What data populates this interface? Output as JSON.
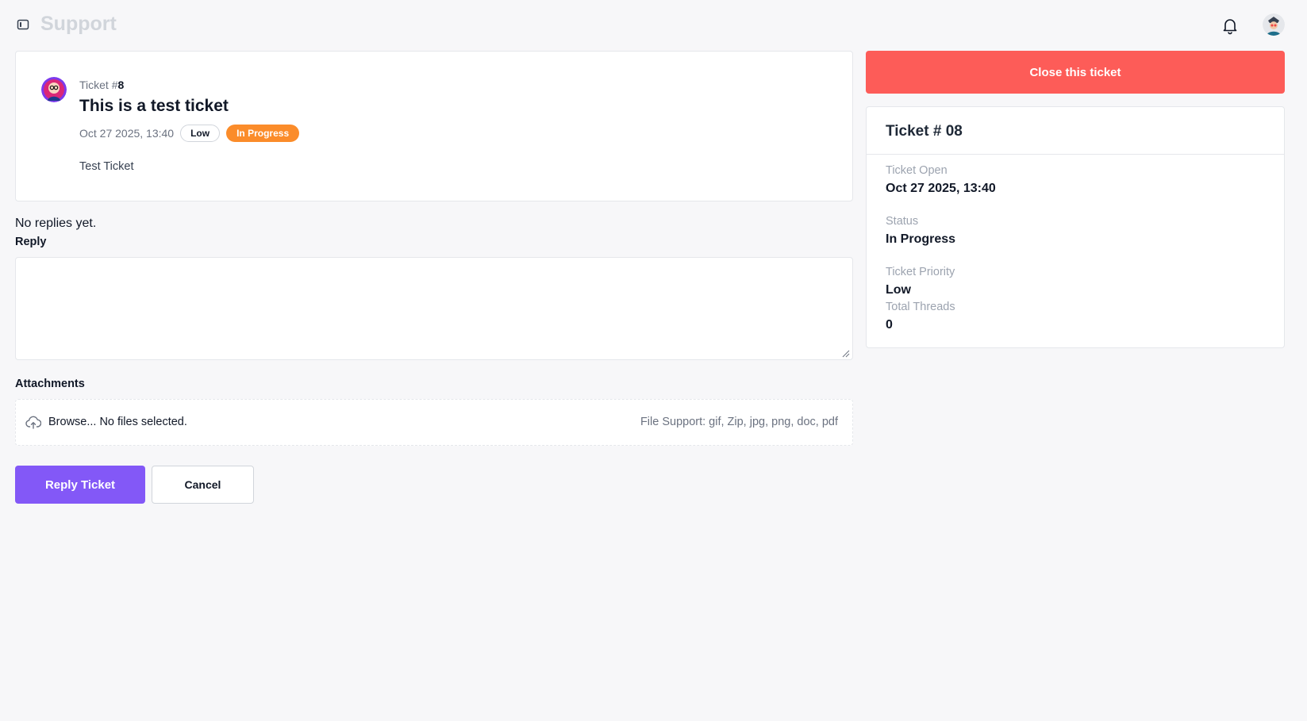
{
  "header": {
    "title": "Support",
    "icons": [
      "sidebar-toggle-icon",
      "bell-icon",
      "user-avatar"
    ]
  },
  "ticket": {
    "id_prefix": "Ticket #",
    "id": "8",
    "title": "This is a test ticket",
    "date": "Oct 27 2025, 13:40",
    "priority": "Low",
    "status": "In Progress",
    "body": "Test Ticket"
  },
  "replies": {
    "empty_text": "No replies yet."
  },
  "reply_form": {
    "label": "Reply",
    "value": "",
    "attachments_label": "Attachments",
    "browse_text": "Browse... No files selected.",
    "file_support": "File Support: gif, Zip, jpg, png, doc, pdf",
    "submit_label": "Reply Ticket",
    "cancel_label": "Cancel"
  },
  "sidebar": {
    "close_label": "Close this ticket",
    "card_title": "Ticket # 08",
    "open_label": "Ticket Open",
    "open_value": "Oct 27 2025, 13:40",
    "status_label": "Status",
    "status_value": "In Progress",
    "priority_label": "Ticket Priority",
    "priority_value": "Low",
    "threads_label": "Total Threads",
    "threads_value": "0"
  },
  "colors": {
    "accent": "#8358f7",
    "danger": "#fd5c58",
    "status_in_progress": "#fb8c2a",
    "background": "#f7f7f9"
  }
}
